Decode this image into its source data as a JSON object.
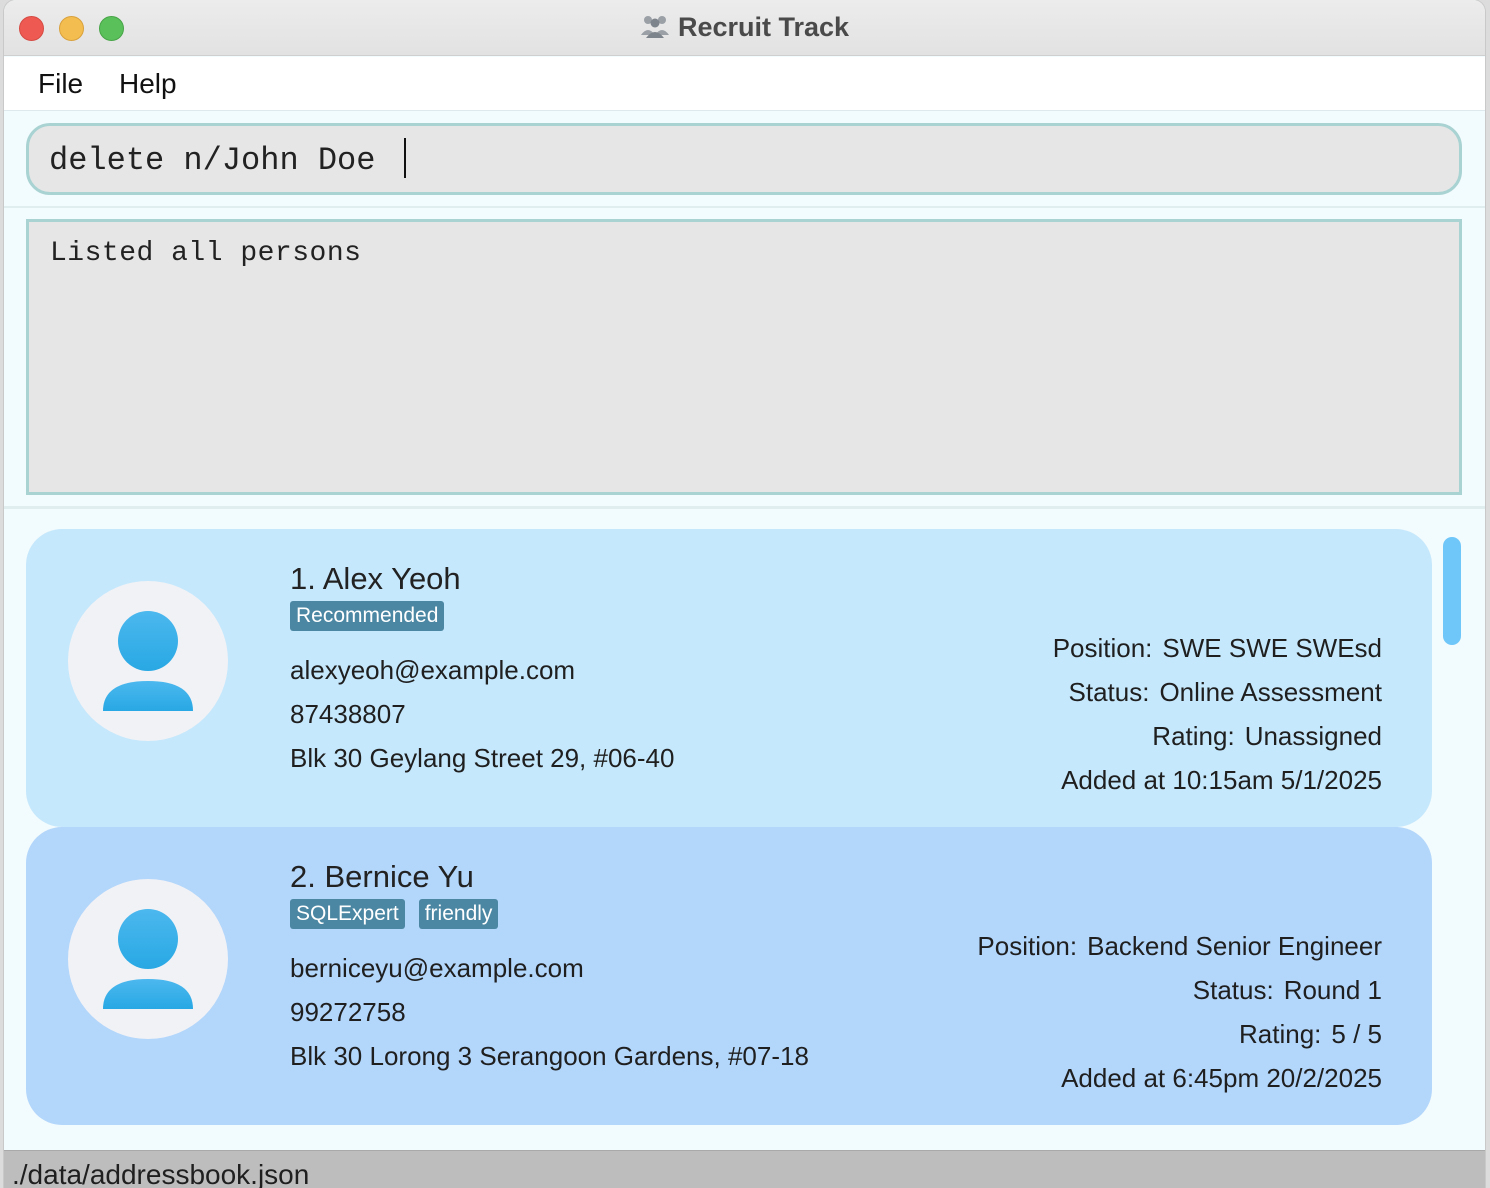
{
  "window": {
    "title": "Recruit Track",
    "app_icon": "people-group-icon"
  },
  "menu": {
    "file": "File",
    "help": "Help"
  },
  "command_box": {
    "value": "delete n/John Doe",
    "placeholder": ""
  },
  "result_display": {
    "text": "Listed all persons"
  },
  "persons": [
    {
      "index_name": "1. Alex Yeoh",
      "tags": [
        "Recommended"
      ],
      "email": "alexyeoh@example.com",
      "phone": "87438807",
      "address": "Blk 30 Geylang Street 29, #06-40",
      "position_label": "Position:",
      "position": "SWE SWE SWEsd",
      "status_label": "Status:",
      "status": "Online Assessment",
      "rating_label": "Rating:",
      "rating": "Unassigned",
      "added": "Added at 10:15am 5/1/2025"
    },
    {
      "index_name": "2. Bernice Yu",
      "tags": [
        "SQLExpert",
        "friendly"
      ],
      "email": "berniceyu@example.com",
      "phone": "99272758",
      "address": "Blk 30 Lorong 3 Serangoon Gardens, #07-18",
      "position_label": "Position:",
      "position": "Backend Senior Engineer",
      "status_label": "Status:",
      "status": "Round 1",
      "rating_label": "Rating:",
      "rating": "5 / 5",
      "added": "Added at 6:45pm 20/2/2025"
    }
  ],
  "status_bar": {
    "path": "./data/addressbook.json"
  },
  "colors": {
    "card_1_bg": "#c6e8fc",
    "card_2_bg": "#b3d6fb",
    "tag_bg": "#4b87a3",
    "scroll_thumb": "#6ec6f9",
    "avatar_blue": "#34aee8"
  }
}
